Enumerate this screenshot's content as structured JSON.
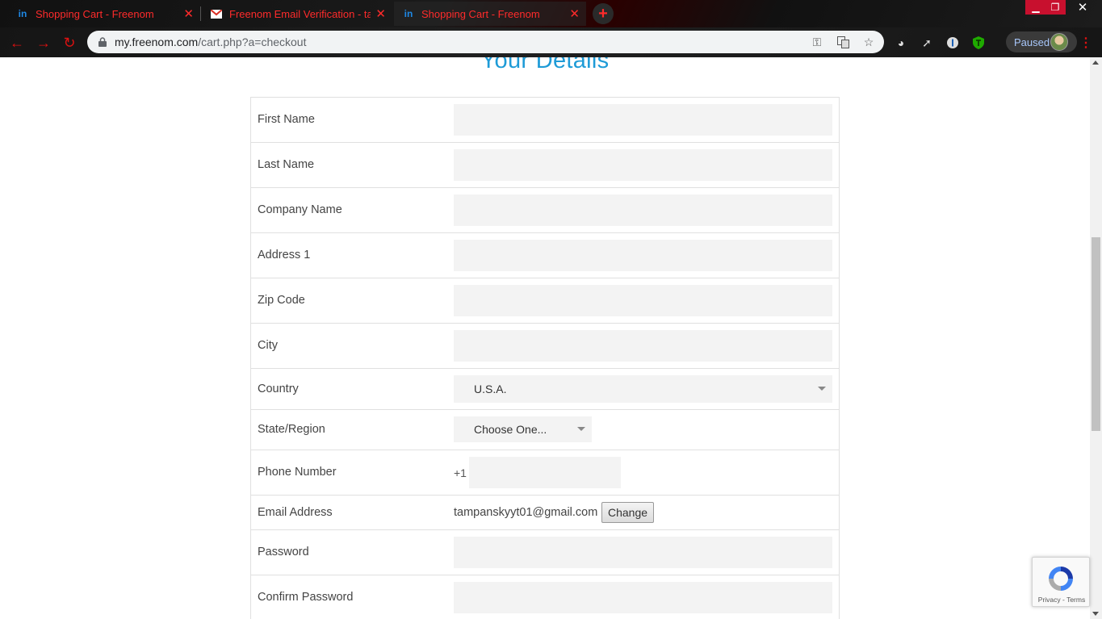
{
  "browser": {
    "tabs": [
      {
        "title": "Shopping Cart - Freenom",
        "icon": "invision-icon"
      },
      {
        "title": "Freenom Email Verification - tam",
        "icon": "gmail-icon"
      },
      {
        "title": "Shopping Cart - Freenom",
        "icon": "invision-icon"
      }
    ],
    "url_domain": "my.freenom.com",
    "url_path": "/cart.php?a=checkout",
    "profile_status": "Paused",
    "accent_color": "#ff2b2b"
  },
  "page": {
    "heading": "Your Details",
    "heading_color": "#1e9bd7",
    "fields": {
      "first_name": {
        "label": "First Name",
        "value": ""
      },
      "last_name": {
        "label": "Last Name",
        "value": ""
      },
      "company_name": {
        "label": "Company Name",
        "value": ""
      },
      "address1": {
        "label": "Address 1",
        "value": ""
      },
      "zip_code": {
        "label": "Zip Code",
        "value": ""
      },
      "city": {
        "label": "City",
        "value": ""
      },
      "country": {
        "label": "Country",
        "selected": "U.S.A."
      },
      "state": {
        "label": "State/Region",
        "selected": "Choose One..."
      },
      "phone": {
        "label": "Phone Number",
        "prefix": "+1",
        "value": ""
      },
      "email": {
        "label": "Email Address",
        "value": "tampanskyyt01@gmail.com",
        "change_label": "Change"
      },
      "password": {
        "label": "Password",
        "value": ""
      },
      "confirm_password": {
        "label": "Confirm Password",
        "value": ""
      }
    }
  },
  "recaptcha": {
    "links": "Privacy - Terms"
  }
}
